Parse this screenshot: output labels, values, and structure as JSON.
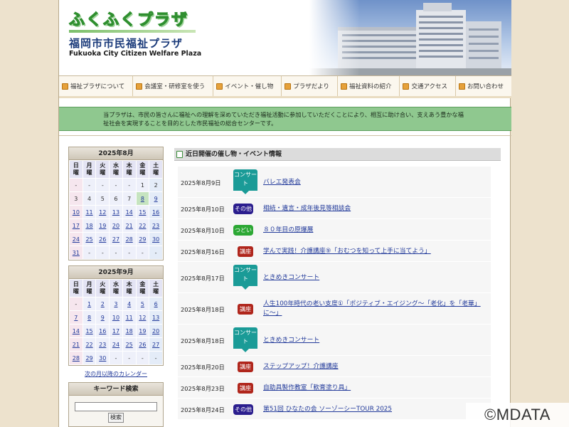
{
  "header": {
    "logo_kana": "ふくふくプラザ",
    "title_jp": "福岡市市民福祉プラザ",
    "title_en": "Fukuoka City Citizen Welfare Plaza"
  },
  "nav": [
    {
      "label": "福祉プラザについて"
    },
    {
      "label": "会議室・研修室を使う"
    },
    {
      "label": "イベント・催し物"
    },
    {
      "label": "プラザだより"
    },
    {
      "label": "福祉資料の紹介"
    },
    {
      "label": "交通アクセス"
    },
    {
      "label": "お問い合わせ"
    }
  ],
  "intro": "当プラザは、市民の皆さんに福祉への理解を深めていただき福祉活動に参加していただくことにより、相互に助け合い、支えあう豊かな福祉社会を実現することを目的とした市民福祉の総合センターです。",
  "calendars": [
    {
      "title": "2025年8月",
      "weekdays": [
        "日曜",
        "月曜",
        "火曜",
        "水曜",
        "木曜",
        "金曜",
        "土曜"
      ],
      "weeks": [
        [
          "-",
          "-",
          "-",
          "-",
          "-",
          "1",
          "2"
        ],
        [
          "3",
          "4",
          "5",
          "6",
          "7",
          "8",
          "9"
        ],
        [
          "10",
          "11",
          "12",
          "13",
          "14",
          "15",
          "16"
        ],
        [
          "17",
          "18",
          "19",
          "20",
          "21",
          "22",
          "23"
        ],
        [
          "24",
          "25",
          "26",
          "27",
          "28",
          "29",
          "30"
        ],
        [
          "31",
          "-",
          "-",
          "-",
          "-",
          "-",
          "-"
        ]
      ],
      "today": "8"
    },
    {
      "title": "2025年9月",
      "weekdays": [
        "日曜",
        "月曜",
        "火曜",
        "水曜",
        "木曜",
        "金曜",
        "土曜"
      ],
      "weeks": [
        [
          "-",
          "1",
          "2",
          "3",
          "4",
          "5",
          "6"
        ],
        [
          "7",
          "8",
          "9",
          "10",
          "11",
          "12",
          "13"
        ],
        [
          "14",
          "15",
          "16",
          "17",
          "18",
          "19",
          "20"
        ],
        [
          "21",
          "22",
          "23",
          "24",
          "25",
          "26",
          "27"
        ],
        [
          "28",
          "29",
          "30",
          "-",
          "-",
          "-",
          "-"
        ]
      ],
      "today": ""
    }
  ],
  "next_calendar_link": "次の月以降のカレンダー",
  "keyword_search": {
    "title": "キーワード検索",
    "button": "検索",
    "value": ""
  },
  "events": {
    "heading": "近日開催の催し物・イベント情報",
    "items": [
      {
        "date": "2025年8月9日",
        "category": "concert",
        "badge": "コンサート",
        "title": "バレエ発表会"
      },
      {
        "date": "2025年8月10日",
        "category": "other",
        "badge": "その他",
        "title": "相続・遺言・成年後見等相談会"
      },
      {
        "date": "2025年8月10日",
        "category": "tsudoi",
        "badge": "つどい",
        "title": "８０年目の原爆展"
      },
      {
        "date": "2025年8月16日",
        "category": "kouza",
        "badge": "講座",
        "title": "学んで実践！介護講座⑨「おむつを知って上手に当てよう」"
      },
      {
        "date": "2025年8月17日",
        "category": "concert",
        "badge": "コンサート",
        "title": "ときめきコンサート"
      },
      {
        "date": "2025年8月18日",
        "category": "kouza",
        "badge": "講座",
        "title": "人生100年時代の老い支度①「ポジティブ・エイジング～「老化」を「老華」に～」"
      },
      {
        "date": "2025年8月18日",
        "category": "concert",
        "badge": "コンサート",
        "title": "ときめきコンサート"
      },
      {
        "date": "2025年8月20日",
        "category": "kouza",
        "badge": "講座",
        "title": "ステップアップ！介護講座"
      },
      {
        "date": "2025年8月23日",
        "category": "kouza",
        "badge": "講座",
        "title": "自助具製作教室「軟膏塗り具」"
      },
      {
        "date": "2025年8月24日",
        "category": "other",
        "badge": "その他",
        "title": "第51回 ひなたの会 ソーゾーシーTOUR 2025"
      }
    ]
  },
  "watermark": "©MDATA"
}
